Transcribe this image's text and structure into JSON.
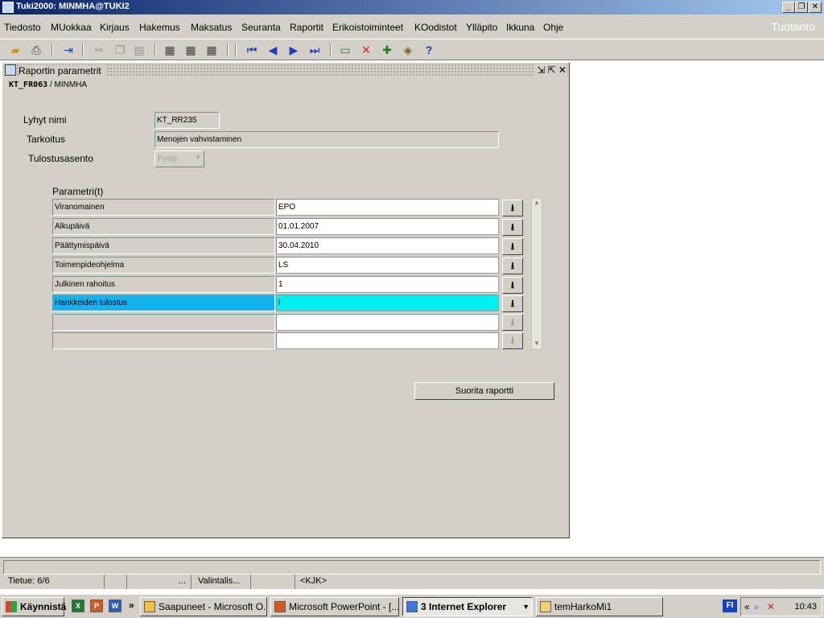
{
  "window": {
    "title": "Tuki2000: MINMHA@TUKI2"
  },
  "menu": {
    "items": [
      "Tiedosto",
      "MUokkaa",
      "Kirjaus",
      "Hakemus",
      "Maksatus",
      "Seuranta",
      "Raportit",
      "Erikoistoiminteet",
      "KOodistot",
      "Ylläpito",
      "Ikkuna",
      "Ohje"
    ],
    "environment": "Tuotanto"
  },
  "toolbar": {
    "icons": [
      "save-icon",
      "print-icon",
      "exit-icon",
      "cut-icon",
      "copy-icon",
      "paste-icon",
      "enter-query-icon",
      "execute-query-icon",
      "cancel-query-icon",
      "first-record-icon",
      "previous-record-icon",
      "next-record-icon",
      "last-record-icon",
      "insert-record-icon",
      "delete-record-icon",
      "duplicate-record-icon",
      "lov-icon",
      "help-icon"
    ]
  },
  "form": {
    "title": "Raportin parametrit",
    "code": "KT_FR063",
    "user": "MINMHA",
    "short_name_label": "Lyhyt nimi",
    "short_name_value": "KT_RR235",
    "purpose_label": "Tarkoitus",
    "purpose_value": "Menojen vahvistaminen",
    "orientation_label": "Tulostusasento",
    "orientation_value": "Pysty",
    "params_label": "Parametri(t)",
    "params": [
      {
        "name": "Viranomainen",
        "value": "EPO"
      },
      {
        "name": "Alkupäivä",
        "value": "01.01.2007"
      },
      {
        "name": "Päättymispäivä",
        "value": "30.04.2010"
      },
      {
        "name": "Toimenpideohjelma",
        "value": "LS"
      },
      {
        "name": "Julkinen rahoitus",
        "value": "1"
      },
      {
        "name": "Hankkeiden tulostus",
        "value": "l"
      },
      {
        "name": "",
        "value": ""
      },
      {
        "name": "",
        "value": ""
      }
    ],
    "run_button": "Suorita raportti"
  },
  "status": {
    "record": "Tietue: 6/6",
    "ellipsis": "...",
    "list": "Valintalis...",
    "mode": "<KJK>"
  },
  "taskbar": {
    "start": "Käynnistä",
    "tasks": [
      "Saapuneet - Microsoft O...",
      "Microsoft PowerPoint - [...",
      "3 Internet Explorer",
      "temHarkoMi1"
    ],
    "lang": "FI",
    "time": "10:43"
  },
  "colors": {
    "selected_row": "#12b4f0",
    "selected_value": "#00f0f0",
    "title_gradient_start": "#0a246a"
  }
}
